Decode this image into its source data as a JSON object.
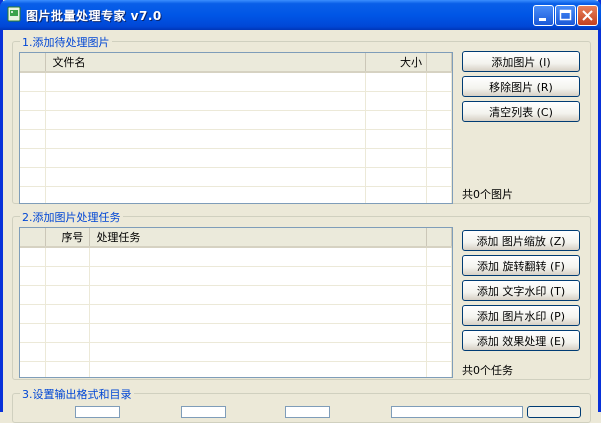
{
  "window": {
    "title": "图片批量处理专家 v7.0",
    "accent": "#0054e3"
  },
  "section1": {
    "title": "1.添加待处理图片",
    "headers": [
      "",
      "文件名",
      "大小"
    ],
    "buttons": [
      "添加图片 (I)",
      "移除图片 (R)",
      "清空列表 (C)"
    ],
    "count": "共0个图片"
  },
  "section2": {
    "title": "2.添加图片处理任务",
    "headers": [
      "",
      "序号",
      "处理任务"
    ],
    "buttons": [
      "添加  图片缩放 (Z)",
      "添加  旋转翻转 (F)",
      "添加  文字水印 (T)",
      "添加  图片水印 (P)",
      "添加  效果处理 (E)"
    ],
    "count": "共0个任务"
  },
  "section3": {
    "title": "3.设置输出格式和目录"
  }
}
